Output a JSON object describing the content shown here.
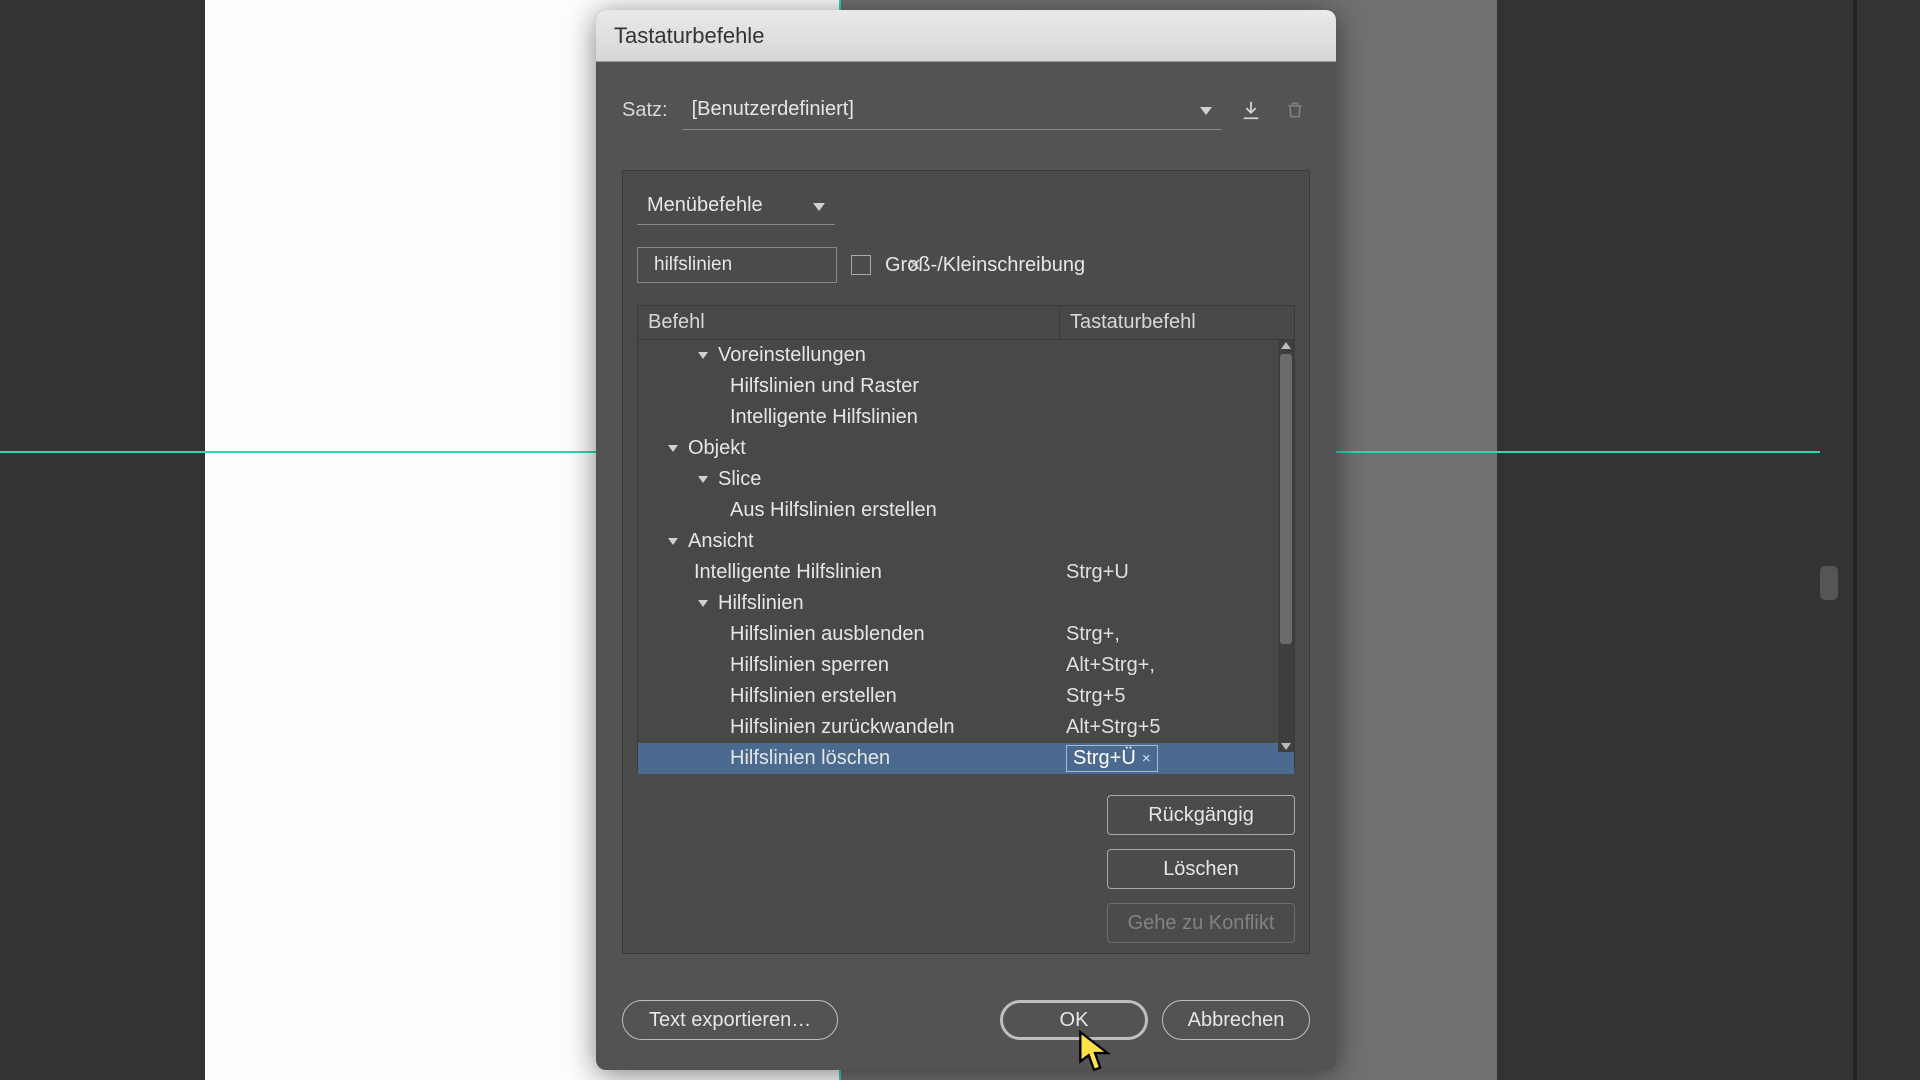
{
  "dialog": {
    "title": "Tastaturbefehle",
    "set_label": "Satz:",
    "set_value": "[Benutzerdefiniert]",
    "save_icon_tooltip": "Speichern",
    "delete_icon_tooltip": "Löschen"
  },
  "panel": {
    "scope_value": "Menübefehle",
    "search_value": "hilfslinien",
    "case_label": "Groß-/Kleinschreibung",
    "case_checked": false,
    "columns": {
      "command": "Befehl",
      "shortcut": "Tastaturbefehl"
    }
  },
  "tree": [
    {
      "type": "group",
      "indent": 2,
      "label": "Voreinstellungen"
    },
    {
      "type": "item",
      "indent": 3,
      "label": "Hilfslinien und Raster",
      "shortcut": ""
    },
    {
      "type": "item",
      "indent": 3,
      "label": "Intelligente Hilfslinien",
      "shortcut": ""
    },
    {
      "type": "group",
      "indent": 1,
      "label": "Objekt"
    },
    {
      "type": "group",
      "indent": 2,
      "label": "Slice"
    },
    {
      "type": "item",
      "indent": 3,
      "label": "Aus Hilfslinien erstellen",
      "shortcut": ""
    },
    {
      "type": "group",
      "indent": 1,
      "label": "Ansicht"
    },
    {
      "type": "item",
      "indent": 2,
      "label": "Intelligente Hilfslinien",
      "shortcut": "Strg+U"
    },
    {
      "type": "group",
      "indent": 2,
      "label": "Hilfslinien"
    },
    {
      "type": "item",
      "indent": 3,
      "label": "Hilfslinien ausblenden",
      "shortcut": "Strg+,"
    },
    {
      "type": "item",
      "indent": 3,
      "label": "Hilfslinien sperren",
      "shortcut": "Alt+Strg+,"
    },
    {
      "type": "item",
      "indent": 3,
      "label": "Hilfslinien erstellen",
      "shortcut": "Strg+5"
    },
    {
      "type": "item",
      "indent": 3,
      "label": "Hilfslinien zurückwandeln",
      "shortcut": "Alt+Strg+5"
    },
    {
      "type": "item",
      "indent": 3,
      "label": "Hilfslinien löschen",
      "shortcut": "Strg+Ü",
      "selected": true,
      "editing": true
    }
  ],
  "buttons": {
    "undo": "Rückgängig",
    "delete": "Löschen",
    "goto_conflict": "Gehe zu Konflikt",
    "export": "Text exportieren…",
    "ok": "OK",
    "cancel": "Abbrechen"
  }
}
